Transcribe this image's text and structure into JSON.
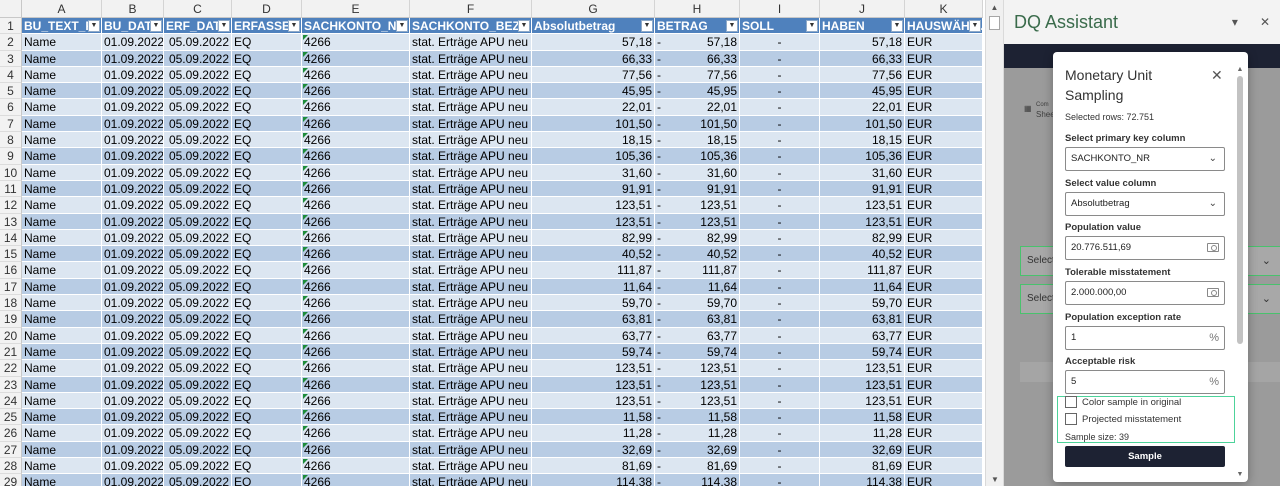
{
  "sheet": {
    "column_letters": [
      "A",
      "B",
      "C",
      "D",
      "E",
      "F",
      "G",
      "H",
      "I",
      "J",
      "K"
    ],
    "headers": [
      "BU_TEXT_F",
      "BU_DAT",
      "ERF_DAT",
      "ERFASSEI",
      "SACHKONTO_NR",
      "SACHKONTO_BEZ",
      "Absolutbetrag",
      "BETRAG",
      "SOLL",
      "HABEN",
      "HAUSWÄHRU"
    ],
    "rows": [
      {
        "n": "2",
        "a": "Name",
        "b": "01.09.2022",
        "c": "05.09.2022",
        "d": "EQ",
        "e": "4266",
        "f": "stat. Erträge APU neu",
        "g": "57,18",
        "h_sign": "-",
        "h": "57,18",
        "i": "-",
        "j": "57,18",
        "k": "EUR"
      },
      {
        "n": "3",
        "a": "Name",
        "b": "01.09.2022",
        "c": "05.09.2022",
        "d": "EQ",
        "e": "4266",
        "f": "stat. Erträge APU neu",
        "g": "66,33",
        "h_sign": "-",
        "h": "66,33",
        "i": "-",
        "j": "66,33",
        "k": "EUR"
      },
      {
        "n": "4",
        "a": "Name",
        "b": "01.09.2022",
        "c": "05.09.2022",
        "d": "EQ",
        "e": "4266",
        "f": "stat. Erträge APU neu",
        "g": "77,56",
        "h_sign": "-",
        "h": "77,56",
        "i": "-",
        "j": "77,56",
        "k": "EUR"
      },
      {
        "n": "5",
        "a": "Name",
        "b": "01.09.2022",
        "c": "05.09.2022",
        "d": "EQ",
        "e": "4266",
        "f": "stat. Erträge APU neu",
        "g": "45,95",
        "h_sign": "-",
        "h": "45,95",
        "i": "-",
        "j": "45,95",
        "k": "EUR"
      },
      {
        "n": "6",
        "a": "Name",
        "b": "01.09.2022",
        "c": "05.09.2022",
        "d": "EQ",
        "e": "4266",
        "f": "stat. Erträge APU neu",
        "g": "22,01",
        "h_sign": "-",
        "h": "22,01",
        "i": "-",
        "j": "22,01",
        "k": "EUR"
      },
      {
        "n": "7",
        "a": "Name",
        "b": "01.09.2022",
        "c": "05.09.2022",
        "d": "EQ",
        "e": "4266",
        "f": "stat. Erträge APU neu",
        "g": "101,50",
        "h_sign": "-",
        "h": "101,50",
        "i": "-",
        "j": "101,50",
        "k": "EUR"
      },
      {
        "n": "8",
        "a": "Name",
        "b": "01.09.2022",
        "c": "05.09.2022",
        "d": "EQ",
        "e": "4266",
        "f": "stat. Erträge APU neu",
        "g": "18,15",
        "h_sign": "-",
        "h": "18,15",
        "i": "-",
        "j": "18,15",
        "k": "EUR"
      },
      {
        "n": "9",
        "a": "Name",
        "b": "01.09.2022",
        "c": "05.09.2022",
        "d": "EQ",
        "e": "4266",
        "f": "stat. Erträge APU neu",
        "g": "105,36",
        "h_sign": "-",
        "h": "105,36",
        "i": "-",
        "j": "105,36",
        "k": "EUR"
      },
      {
        "n": "10",
        "a": "Name",
        "b": "01.09.2022",
        "c": "05.09.2022",
        "d": "EQ",
        "e": "4266",
        "f": "stat. Erträge APU neu",
        "g": "31,60",
        "h_sign": "-",
        "h": "31,60",
        "i": "-",
        "j": "31,60",
        "k": "EUR"
      },
      {
        "n": "11",
        "a": "Name",
        "b": "01.09.2022",
        "c": "05.09.2022",
        "d": "EQ",
        "e": "4266",
        "f": "stat. Erträge APU neu",
        "g": "91,91",
        "h_sign": "-",
        "h": "91,91",
        "i": "-",
        "j": "91,91",
        "k": "EUR"
      },
      {
        "n": "12",
        "a": "Name",
        "b": "01.09.2022",
        "c": "05.09.2022",
        "d": "EQ",
        "e": "4266",
        "f": "stat. Erträge APU neu",
        "g": "123,51",
        "h_sign": "-",
        "h": "123,51",
        "i": "-",
        "j": "123,51",
        "k": "EUR"
      },
      {
        "n": "13",
        "a": "Name",
        "b": "01.09.2022",
        "c": "05.09.2022",
        "d": "EQ",
        "e": "4266",
        "f": "stat. Erträge APU neu",
        "g": "123,51",
        "h_sign": "-",
        "h": "123,51",
        "i": "-",
        "j": "123,51",
        "k": "EUR"
      },
      {
        "n": "14",
        "a": "Name",
        "b": "01.09.2022",
        "c": "05.09.2022",
        "d": "EQ",
        "e": "4266",
        "f": "stat. Erträge APU neu",
        "g": "82,99",
        "h_sign": "-",
        "h": "82,99",
        "i": "-",
        "j": "82,99",
        "k": "EUR"
      },
      {
        "n": "15",
        "a": "Name",
        "b": "01.09.2022",
        "c": "05.09.2022",
        "d": "EQ",
        "e": "4266",
        "f": "stat. Erträge APU neu",
        "g": "40,52",
        "h_sign": "-",
        "h": "40,52",
        "i": "-",
        "j": "40,52",
        "k": "EUR"
      },
      {
        "n": "16",
        "a": "Name",
        "b": "01.09.2022",
        "c": "05.09.2022",
        "d": "EQ",
        "e": "4266",
        "f": "stat. Erträge APU neu",
        "g": "111,87",
        "h_sign": "-",
        "h": "111,87",
        "i": "-",
        "j": "111,87",
        "k": "EUR"
      },
      {
        "n": "17",
        "a": "Name",
        "b": "01.09.2022",
        "c": "05.09.2022",
        "d": "EQ",
        "e": "4266",
        "f": "stat. Erträge APU neu",
        "g": "11,64",
        "h_sign": "-",
        "h": "11,64",
        "i": "-",
        "j": "11,64",
        "k": "EUR"
      },
      {
        "n": "18",
        "a": "Name",
        "b": "01.09.2022",
        "c": "05.09.2022",
        "d": "EQ",
        "e": "4266",
        "f": "stat. Erträge APU neu",
        "g": "59,70",
        "h_sign": "-",
        "h": "59,70",
        "i": "-",
        "j": "59,70",
        "k": "EUR"
      },
      {
        "n": "19",
        "a": "Name",
        "b": "01.09.2022",
        "c": "05.09.2022",
        "d": "EQ",
        "e": "4266",
        "f": "stat. Erträge APU neu",
        "g": "63,81",
        "h_sign": "-",
        "h": "63,81",
        "i": "-",
        "j": "63,81",
        "k": "EUR"
      },
      {
        "n": "20",
        "a": "Name",
        "b": "01.09.2022",
        "c": "05.09.2022",
        "d": "EQ",
        "e": "4266",
        "f": "stat. Erträge APU neu",
        "g": "63,77",
        "h_sign": "-",
        "h": "63,77",
        "i": "-",
        "j": "63,77",
        "k": "EUR"
      },
      {
        "n": "21",
        "a": "Name",
        "b": "01.09.2022",
        "c": "05.09.2022",
        "d": "EQ",
        "e": "4266",
        "f": "stat. Erträge APU neu",
        "g": "59,74",
        "h_sign": "-",
        "h": "59,74",
        "i": "-",
        "j": "59,74",
        "k": "EUR"
      },
      {
        "n": "22",
        "a": "Name",
        "b": "01.09.2022",
        "c": "05.09.2022",
        "d": "EQ",
        "e": "4266",
        "f": "stat. Erträge APU neu",
        "g": "123,51",
        "h_sign": "-",
        "h": "123,51",
        "i": "-",
        "j": "123,51",
        "k": "EUR"
      },
      {
        "n": "23",
        "a": "Name",
        "b": "01.09.2022",
        "c": "05.09.2022",
        "d": "EQ",
        "e": "4266",
        "f": "stat. Erträge APU neu",
        "g": "123,51",
        "h_sign": "-",
        "h": "123,51",
        "i": "-",
        "j": "123,51",
        "k": "EUR"
      },
      {
        "n": "24",
        "a": "Name",
        "b": "01.09.2022",
        "c": "05.09.2022",
        "d": "EQ",
        "e": "4266",
        "f": "stat. Erträge APU neu",
        "g": "123,51",
        "h_sign": "-",
        "h": "123,51",
        "i": "-",
        "j": "123,51",
        "k": "EUR"
      },
      {
        "n": "25",
        "a": "Name",
        "b": "01.09.2022",
        "c": "05.09.2022",
        "d": "EQ",
        "e": "4266",
        "f": "stat. Erträge APU neu",
        "g": "11,58",
        "h_sign": "-",
        "h": "11,58",
        "i": "-",
        "j": "11,58",
        "k": "EUR"
      },
      {
        "n": "26",
        "a": "Name",
        "b": "01.09.2022",
        "c": "05.09.2022",
        "d": "EQ",
        "e": "4266",
        "f": "stat. Erträge APU neu",
        "g": "11,28",
        "h_sign": "-",
        "h": "11,28",
        "i": "-",
        "j": "11,28",
        "k": "EUR"
      },
      {
        "n": "27",
        "a": "Name",
        "b": "01.09.2022",
        "c": "05.09.2022",
        "d": "EQ",
        "e": "4266",
        "f": "stat. Erträge APU neu",
        "g": "32,69",
        "h_sign": "-",
        "h": "32,69",
        "i": "-",
        "j": "32,69",
        "k": "EUR"
      },
      {
        "n": "28",
        "a": "Name",
        "b": "01.09.2022",
        "c": "05.09.2022",
        "d": "EQ",
        "e": "4266",
        "f": "stat. Erträge APU neu",
        "g": "81,69",
        "h_sign": "-",
        "h": "81,69",
        "i": "-",
        "j": "81,69",
        "k": "EUR"
      },
      {
        "n": "29",
        "a": "Name",
        "b": "01.09.2022",
        "c": "05.09.2022",
        "d": "EQ",
        "e": "4266",
        "f": "stat. Erträge APU neu",
        "g": "114,38",
        "h_sign": "-",
        "h": "114,38",
        "i": "-",
        "j": "114,38",
        "k": "EUR"
      }
    ]
  },
  "taskpane": {
    "title": "DQ Assistant",
    "collapse_icon": "chevron-down-icon",
    "close_icon": "close-icon",
    "bg_small_label": "Com",
    "bg_sheet_label": "Shee",
    "bg_select_1": "Select",
    "bg_select_2": "Select"
  },
  "modal": {
    "title": "Monetary Unit Sampling",
    "selected_rows": "Selected rows: 72.751",
    "primary_key_label": "Select primary key column",
    "primary_key_value": "SACHKONTO_NR",
    "value_column_label": "Select value column",
    "value_column_value": "Absolutbetrag",
    "population_value_label": "Population value",
    "population_value": "20.776.511,69",
    "tolerable_misstatement_label": "Tolerable misstatement",
    "tolerable_misstatement": "2.000.000,00",
    "exception_rate_label": "Population exception rate",
    "exception_rate": "1",
    "acceptable_risk_label": "Acceptable risk",
    "acceptable_risk": "5",
    "percent_suffix": "%",
    "color_sample_label": "Color sample in original",
    "projected_misstatement_label": "Projected misstatement",
    "sample_size": "Sample size: 39",
    "sample_button": "Sample"
  },
  "colors": {
    "header_blue": "#4f81bd",
    "row_light": "#dce6f1",
    "row_dark": "#b8cce4",
    "accent_green": "#3a6b4b",
    "highlight_green": "#4dd39a",
    "button_dark": "#1d2233"
  }
}
